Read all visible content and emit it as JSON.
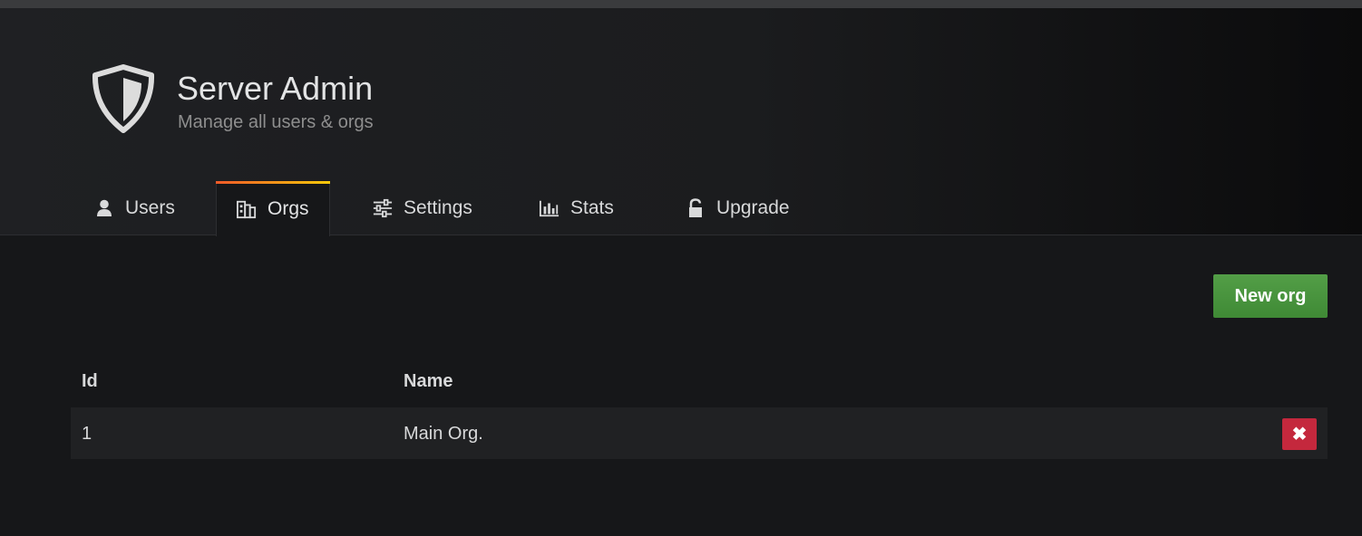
{
  "header": {
    "title": "Server Admin",
    "subtitle": "Manage all users & orgs",
    "icon": "shield-icon"
  },
  "tabs": [
    {
      "label": "Users",
      "icon": "user-icon",
      "active": false
    },
    {
      "label": "Orgs",
      "icon": "building-icon",
      "active": true
    },
    {
      "label": "Settings",
      "icon": "sliders-icon",
      "active": false
    },
    {
      "label": "Stats",
      "icon": "bar-chart-icon",
      "active": false
    },
    {
      "label": "Upgrade",
      "icon": "unlock-icon",
      "active": false
    }
  ],
  "actions": {
    "new_org_label": "New org"
  },
  "table": {
    "columns": [
      "Id",
      "Name"
    ],
    "rows": [
      {
        "id": "1",
        "name": "Main Org."
      }
    ],
    "delete_icon": "✖"
  },
  "colors": {
    "accent_gradient_start": "#f05a28",
    "accent_gradient_end": "#fbca0a",
    "success": "#539e47",
    "danger": "#c4283d"
  }
}
